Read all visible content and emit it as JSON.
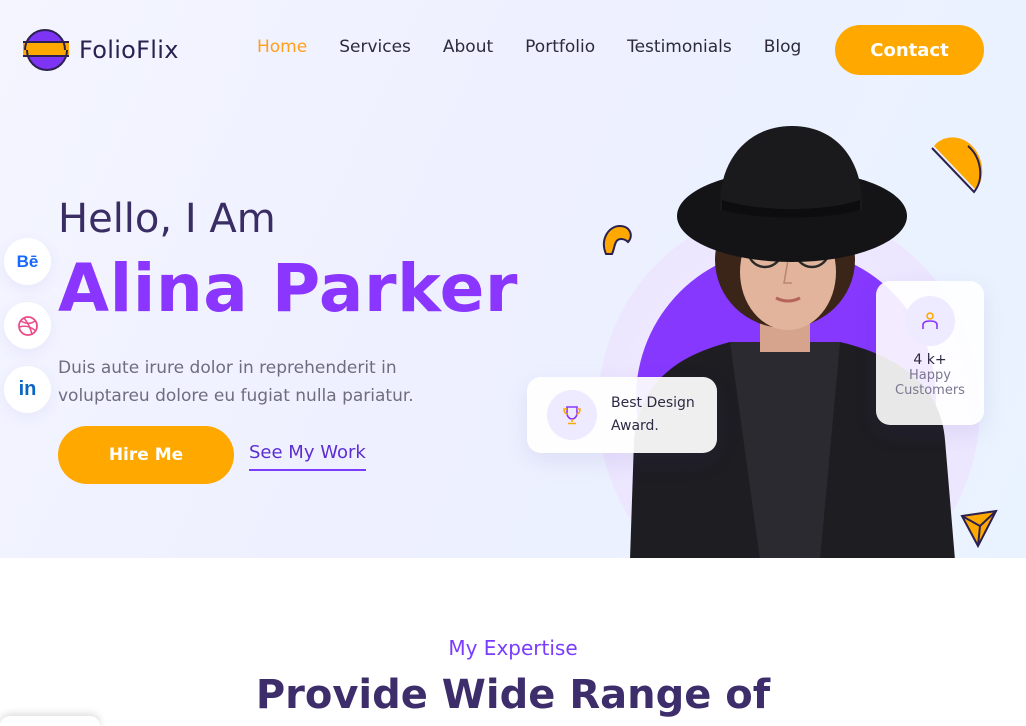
{
  "brand": {
    "name": "FolioFlix"
  },
  "nav": {
    "items": [
      {
        "label": "Home",
        "active": true
      },
      {
        "label": "Services"
      },
      {
        "label": "About"
      },
      {
        "label": "Portfolio"
      },
      {
        "label": "Testimonials"
      },
      {
        "label": "Blog"
      }
    ],
    "contact_label": "Contact"
  },
  "social": [
    {
      "name": "behance-icon",
      "glyph": "Bē",
      "color": "#1769ff"
    },
    {
      "name": "dribbble-icon",
      "glyph": "",
      "color": "#ea4c89"
    },
    {
      "name": "linkedin-icon",
      "glyph": "in",
      "color": "#0a66c2"
    }
  ],
  "hero": {
    "greeting": "Hello, I Am",
    "name": "Alina Parker",
    "description": "Duis aute irure dolor in reprehenderit in voluptareu dolore eu fugiat nulla pariatur.",
    "hire_label": "Hire Me",
    "see_work_label": "See My Work"
  },
  "award_card": {
    "line1": "Best Design",
    "line2": "Award."
  },
  "customers_card": {
    "count": "4 k+",
    "line1": "Happy",
    "line2": "Customers"
  },
  "expertise": {
    "subtitle": "My Expertise",
    "title": "Provide Wide Range of"
  },
  "colors": {
    "accent": "#8a36ff",
    "orange": "#ffa800",
    "nav_active": "#ff9f1c"
  }
}
